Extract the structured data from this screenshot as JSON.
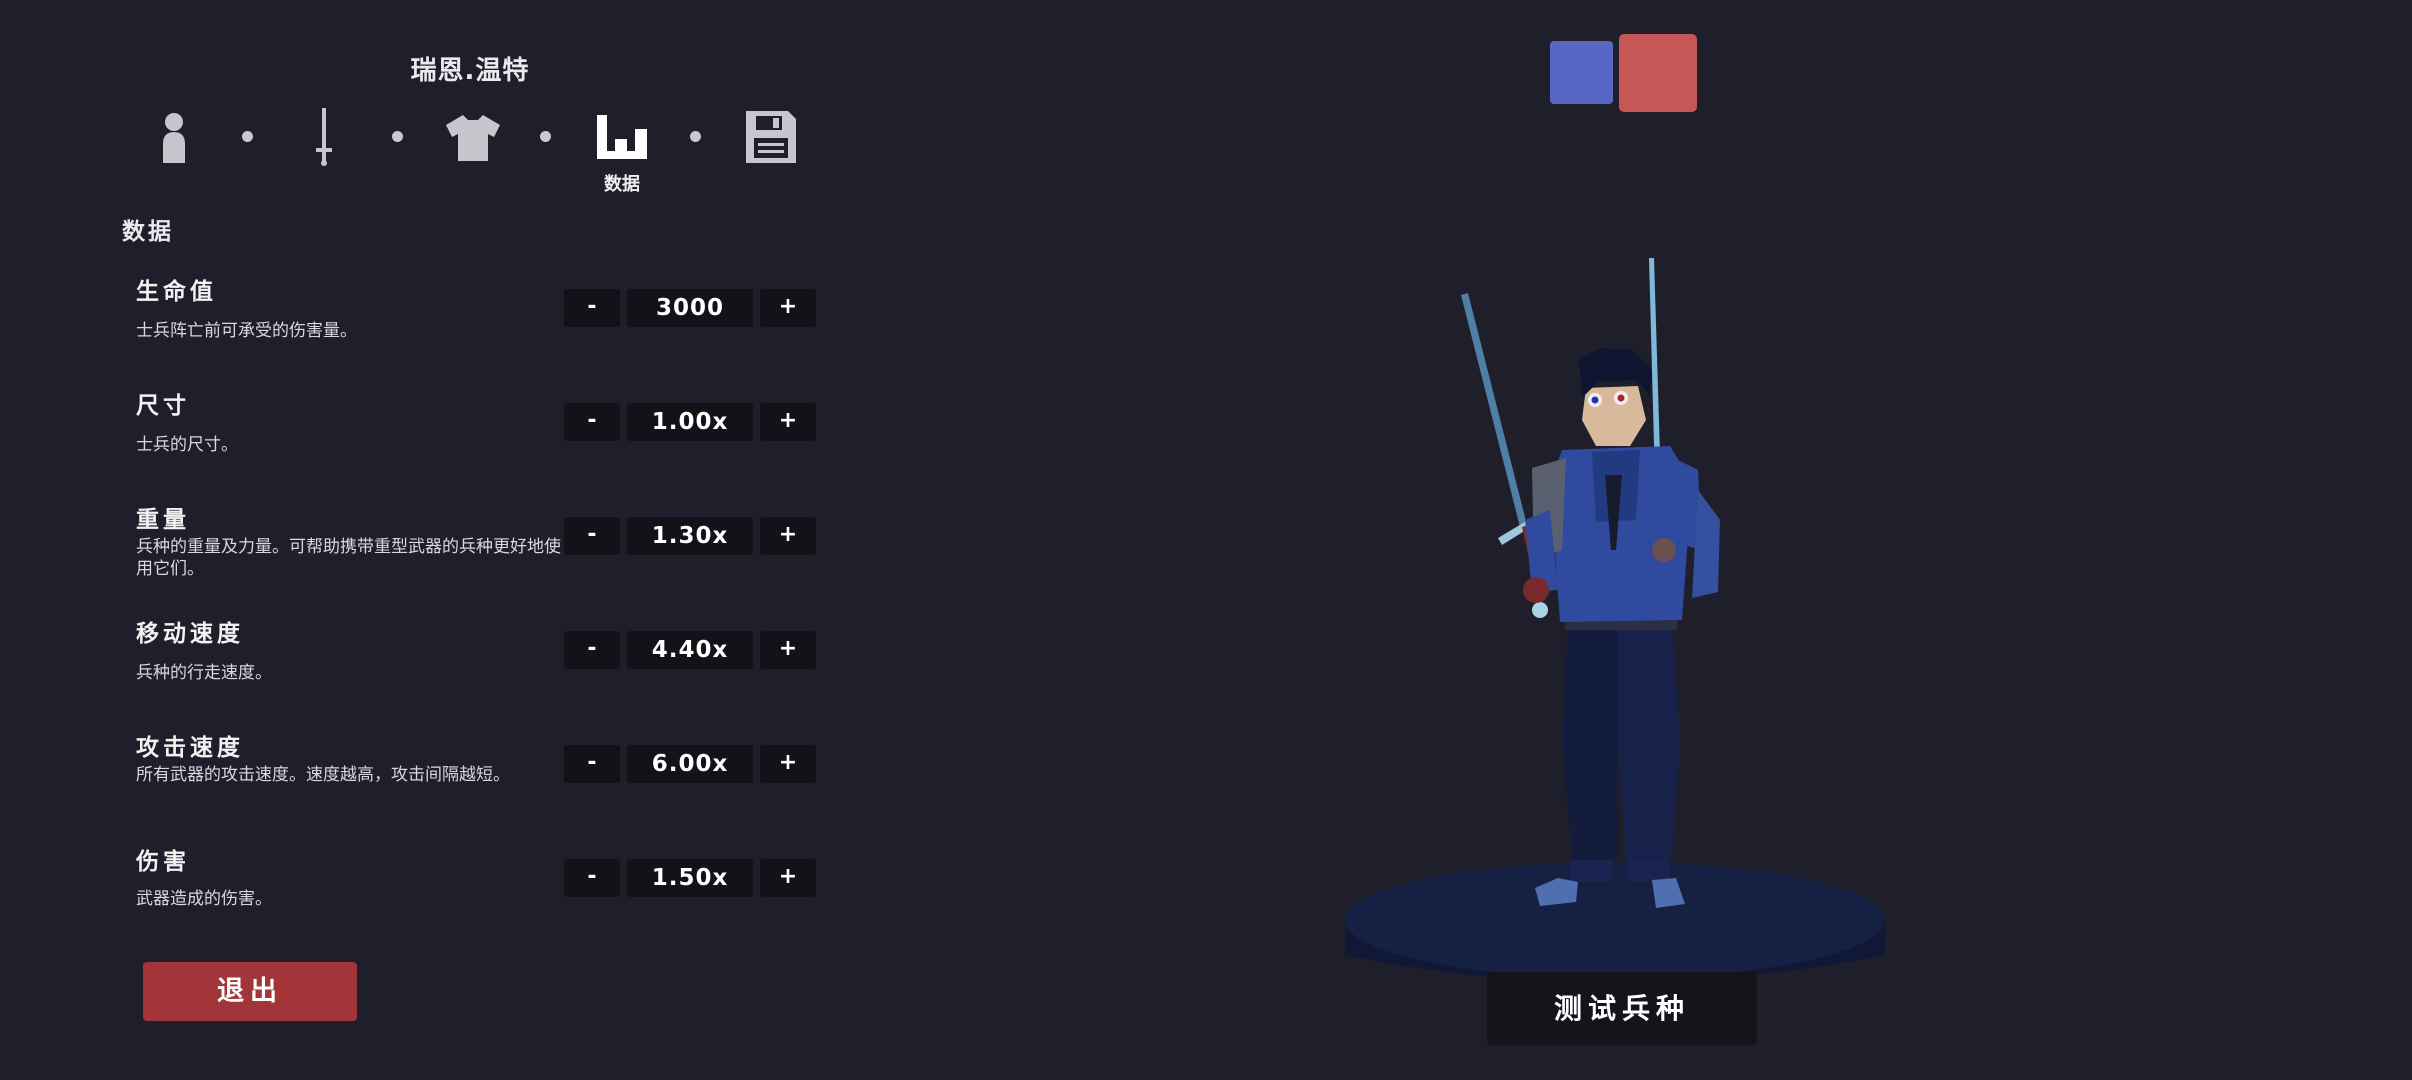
{
  "unit": {
    "name": "瑞恩.温特"
  },
  "steps": [
    {
      "icon": "person-icon"
    },
    {
      "icon": "sword-icon"
    },
    {
      "icon": "shirt-icon"
    },
    {
      "icon": "bar-chart-icon",
      "label": "数据",
      "active": true
    },
    {
      "icon": "save-disk-icon"
    }
  ],
  "section": {
    "title": "数据"
  },
  "stats": [
    {
      "name": "生命值",
      "desc": "士兵阵亡前可承受的伤害量。",
      "value": "3000"
    },
    {
      "name": "尺寸",
      "desc": "士兵的尺寸。",
      "value": "1.00x"
    },
    {
      "name": "重量",
      "desc": "兵种的重量及力量。可帮助携带重型武器的兵种更好地使用它们。",
      "value": "1.30x"
    },
    {
      "name": "移动速度",
      "desc": "兵种的行走速度。",
      "value": "4.40x"
    },
    {
      "name": "攻击速度",
      "desc": "所有武器的攻击速度。速度越高，攻击间隔越短。",
      "value": "6.00x"
    },
    {
      "name": "伤害",
      "desc": "武器造成的伤害。",
      "value": "1.50x"
    }
  ],
  "controls": {
    "minus": "-",
    "plus": "+"
  },
  "buttons": {
    "exit": "退出",
    "test_unit": "测试兵种"
  },
  "colors": {
    "team_blue": "#5867c3",
    "team_red": "#c65756",
    "exit": "#a13538",
    "background": "#1f1f2b"
  }
}
